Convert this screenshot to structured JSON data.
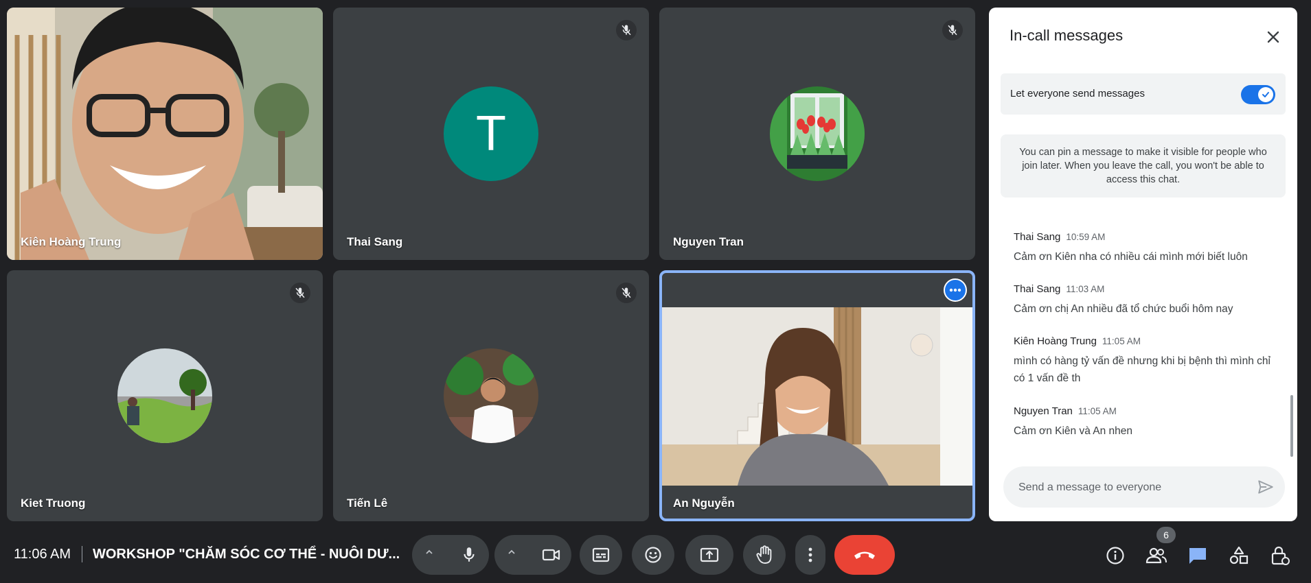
{
  "tiles": [
    {
      "name": "Kiên Hoàng Trung",
      "muted": false
    },
    {
      "name": "Thai Sang",
      "muted": true,
      "initial": "T"
    },
    {
      "name": "Nguyen Tran",
      "muted": true
    },
    {
      "name": "Kiet Truong",
      "muted": true
    },
    {
      "name": "Tiến Lê",
      "muted": true
    },
    {
      "name": "An Nguyễn",
      "muted": false,
      "active_speaker": true
    }
  ],
  "panel": {
    "title": "In-call messages",
    "toggle_label": "Let everyone send messages",
    "toggle_on": true,
    "info": "You can pin a message to make it visible for people who join later. When you leave the call, you won't be able to access this chat.",
    "messages": [
      {
        "sender": "Thai Sang",
        "time": "10:59 AM",
        "text": "Cảm ơn Kiên nha có nhiều cái mình mới biết luôn"
      },
      {
        "sender": "Thai Sang",
        "time": "11:03 AM",
        "text": "Cảm ơn chị An nhiều đã tổ chức buổi hôm nay"
      },
      {
        "sender": "Kiên Hoàng Trung",
        "time": "11:05 AM",
        "text": "mình có hàng tỷ vấn đề nhưng khi bị bệnh thì mình chỉ có 1 vấn đề th"
      },
      {
        "sender": "Nguyen Tran",
        "time": "11:05 AM",
        "text": "Cảm ơn Kiên và An nhen"
      }
    ],
    "compose_placeholder": "Send a message to everyone"
  },
  "bottom_bar": {
    "time": "11:06 AM",
    "meeting_title": "WORKSHOP \"CHĂM SÓC CƠ THỂ - NUÔI DƯ...",
    "participant_count": "6"
  },
  "colors": {
    "accent": "#1a73e8",
    "hangup": "#ea4335",
    "tile": "#3c4043",
    "background": "#202124"
  },
  "icons": [
    "mic-off-icon",
    "more-options-icon",
    "close-icon",
    "check-icon",
    "send-icon",
    "chevron-up-icon",
    "mic-icon",
    "camera-icon",
    "captions-icon",
    "emoji-icon",
    "present-icon",
    "raise-hand-icon",
    "more-vert-icon",
    "hang-up-icon",
    "info-icon",
    "people-icon",
    "chat-icon",
    "activities-icon",
    "host-controls-icon"
  ]
}
